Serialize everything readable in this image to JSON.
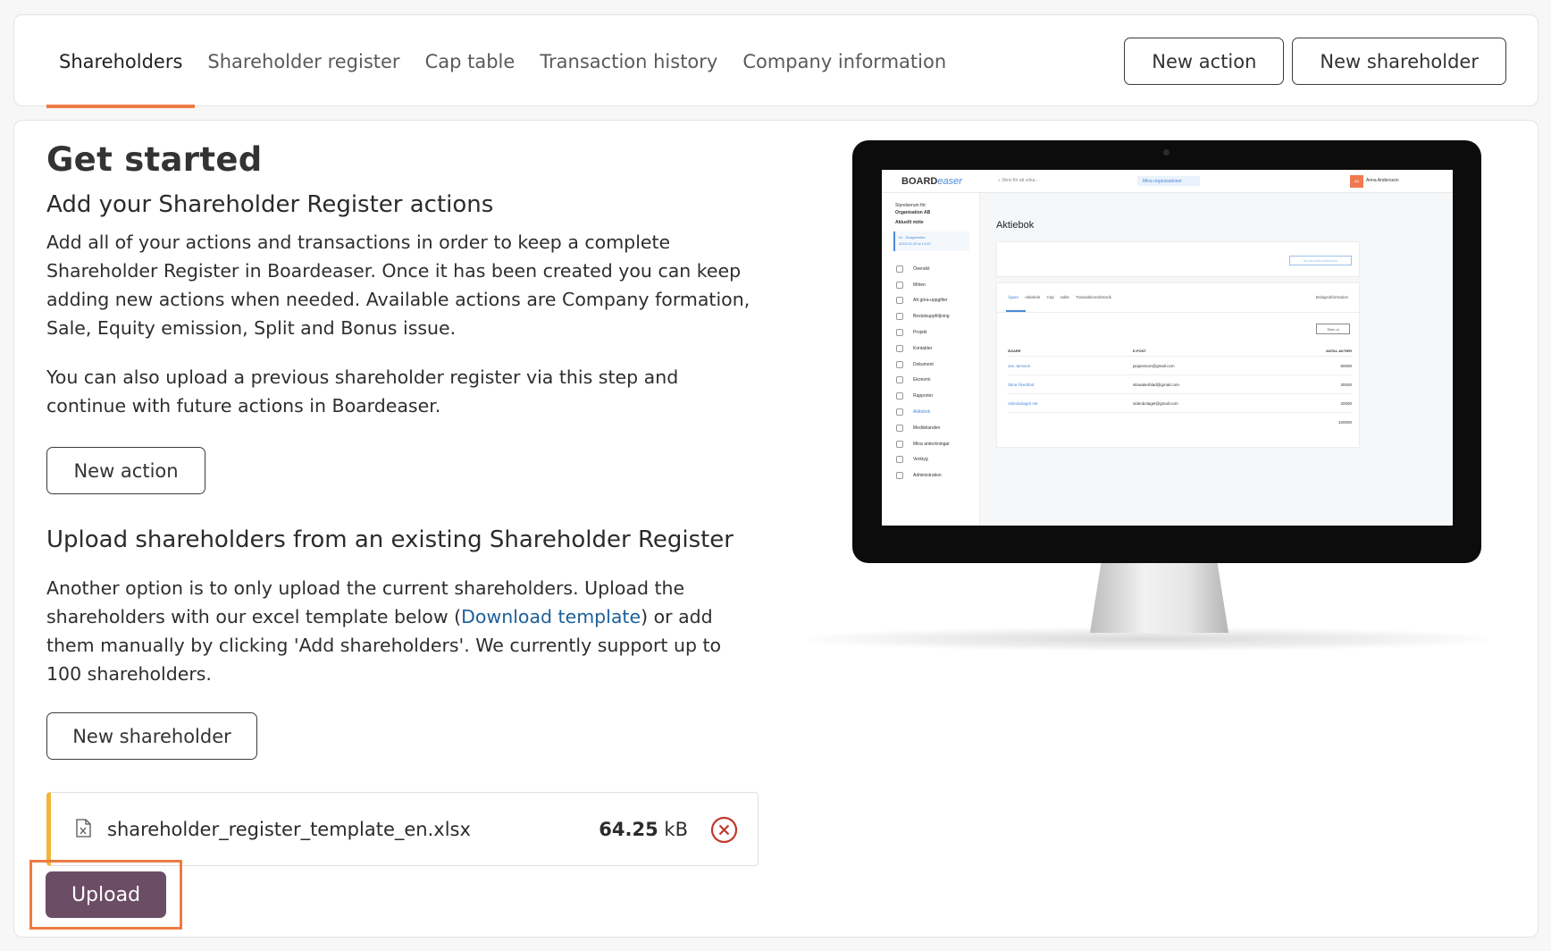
{
  "nav": {
    "tabs": [
      {
        "label": "Shareholders",
        "active": true
      },
      {
        "label": "Shareholder register",
        "active": false
      },
      {
        "label": "Cap table",
        "active": false
      },
      {
        "label": "Transaction history",
        "active": false
      },
      {
        "label": "Company information",
        "active": false
      }
    ],
    "new_action_label": "New action",
    "new_shareholder_label": "New shareholder"
  },
  "main": {
    "title": "Get started",
    "section1": {
      "heading": "Add your Shareholder Register actions",
      "paragraph1": "Add all of your actions and transactions in order to keep a complete Shareholder Register in Boardeaser. Once it has been created you can keep adding new actions when needed. Available actions are Company formation, Sale, Equity emission, Split and Bonus issue.",
      "paragraph2": "You can also upload a previous shareholder register via this step and continue with future actions in Boardeaser.",
      "button_label": "New action"
    },
    "section2": {
      "heading": "Upload shareholders from an existing Shareholder Register",
      "text_before_link": "Another option is to only upload the current shareholders. Upload the shareholders with our excel template below (",
      "link_label": "Download template",
      "text_after_link": ") or add them manually by clicking 'Add shareholders'. We currently support up to 100 shareholders.",
      "button_label": "New shareholder"
    },
    "file": {
      "name": "shareholder_register_template_en.xlsx",
      "size_value": "64.25",
      "size_unit": "kB",
      "icon": "excel-file-icon",
      "remove_icon": "remove-circle-icon"
    },
    "upload_label": "Upload"
  },
  "illustration": {
    "logo_bold": "BOARD",
    "logo_italic": "easer",
    "search_placeholder": "Skriv för att söka...",
    "orgs_label": "Mina organisationer",
    "user_name": "Anna Andersson",
    "avatar_initials": "AA",
    "org_caption": "Styrelserum för:",
    "org_name": "Organisation AB",
    "meeting_heading": "Aktuellt möte",
    "meeting_name": "#1 - Budgetmöte",
    "meeting_date": "2023-01-30 kl 14:00",
    "nav": [
      "Översikt",
      "Möten",
      "Att göra-uppgifter",
      "Beslutsuppföljning",
      "Projekt",
      "Kontakter",
      "Dokument",
      "Ekonomi",
      "Rapporter",
      "Aktiebok",
      "Meddelanden",
      "Mina anteckningar",
      "Verktyg",
      "Administration"
    ],
    "page_title": "Aktiebok",
    "new_transaction_label": "Ny transaktionshändelse",
    "tabs": [
      "Ägare",
      "Aktiebok",
      "Cap table",
      "Transaktionshistorik"
    ],
    "tab_right": "Bolagsinformation",
    "print_label": "Skriv ut",
    "table_headers": [
      "ÄGARE",
      "E-POST",
      "ANTAL AKTIER"
    ],
    "rows": [
      {
        "name": "Jan Jansson",
        "email": "janjansson@gmail.com",
        "shares": "50000"
      },
      {
        "name": "Stina Åkerblad",
        "email": "stinaakerblad@gmail.com",
        "shares": "30000"
      },
      {
        "name": "Videobolaget AB",
        "email": "videobolaget@gmail.com",
        "shares": "20000"
      }
    ],
    "total": "100000"
  }
}
